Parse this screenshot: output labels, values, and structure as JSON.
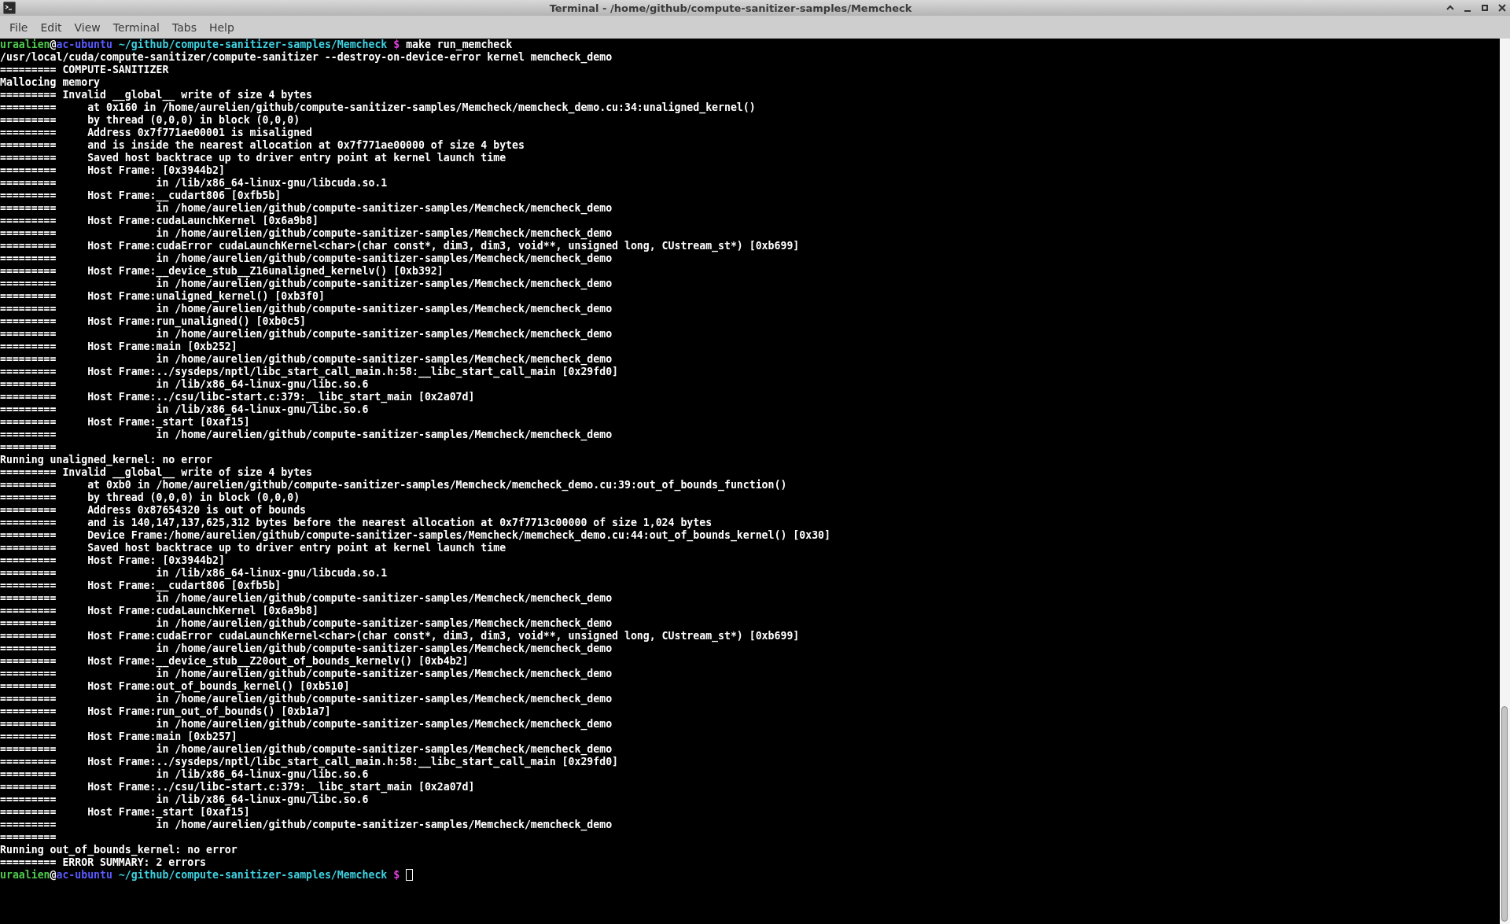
{
  "window": {
    "title": "Terminal - /home/github/compute-sanitizer-samples/Memcheck"
  },
  "menu": [
    "File",
    "Edit",
    "View",
    "Terminal",
    "Tabs",
    "Help"
  ],
  "lines": [
    {
      "kind": "prompt",
      "user": "uraalien",
      "at": "@",
      "host": "ac-ubuntu",
      "path": "~/github/compute-sanitizer-samples/Memcheck",
      "symbol": "$",
      "command": "make run_memcheck"
    },
    {
      "kind": "output",
      "text": "/usr/local/cuda/compute-sanitizer/compute-sanitizer --destroy-on-device-error kernel memcheck_demo"
    },
    {
      "kind": "output",
      "text": "========= COMPUTE-SANITIZER"
    },
    {
      "kind": "output",
      "text": "Mallocing memory"
    },
    {
      "kind": "output",
      "text": "========= Invalid __global__ write of size 4 bytes"
    },
    {
      "kind": "output",
      "text": "=========     at 0x160 in /home/aurelien/github/compute-sanitizer-samples/Memcheck/memcheck_demo.cu:34:unaligned_kernel()"
    },
    {
      "kind": "output",
      "text": "=========     by thread (0,0,0) in block (0,0,0)"
    },
    {
      "kind": "output",
      "text": "=========     Address 0x7f771ae00001 is misaligned"
    },
    {
      "kind": "output",
      "text": "=========     and is inside the nearest allocation at 0x7f771ae00000 of size 4 bytes"
    },
    {
      "kind": "output",
      "text": "=========     Saved host backtrace up to driver entry point at kernel launch time"
    },
    {
      "kind": "output",
      "text": "=========     Host Frame: [0x3944b2]"
    },
    {
      "kind": "output",
      "text": "=========                in /lib/x86_64-linux-gnu/libcuda.so.1"
    },
    {
      "kind": "output",
      "text": "=========     Host Frame:__cudart806 [0xfb5b]"
    },
    {
      "kind": "output",
      "text": "=========                in /home/aurelien/github/compute-sanitizer-samples/Memcheck/memcheck_demo"
    },
    {
      "kind": "output",
      "text": "=========     Host Frame:cudaLaunchKernel [0x6a9b8]"
    },
    {
      "kind": "output",
      "text": "=========                in /home/aurelien/github/compute-sanitizer-samples/Memcheck/memcheck_demo"
    },
    {
      "kind": "output",
      "text": "=========     Host Frame:cudaError cudaLaunchKernel<char>(char const*, dim3, dim3, void**, unsigned long, CUstream_st*) [0xb699]"
    },
    {
      "kind": "output",
      "text": "=========                in /home/aurelien/github/compute-sanitizer-samples/Memcheck/memcheck_demo"
    },
    {
      "kind": "output",
      "text": "=========     Host Frame:__device_stub__Z16unaligned_kernelv() [0xb392]"
    },
    {
      "kind": "output",
      "text": "=========                in /home/aurelien/github/compute-sanitizer-samples/Memcheck/memcheck_demo"
    },
    {
      "kind": "output",
      "text": "=========     Host Frame:unaligned_kernel() [0xb3f0]"
    },
    {
      "kind": "output",
      "text": "=========                in /home/aurelien/github/compute-sanitizer-samples/Memcheck/memcheck_demo"
    },
    {
      "kind": "output",
      "text": "=========     Host Frame:run_unaligned() [0xb0c5]"
    },
    {
      "kind": "output",
      "text": "=========                in /home/aurelien/github/compute-sanitizer-samples/Memcheck/memcheck_demo"
    },
    {
      "kind": "output",
      "text": "=========     Host Frame:main [0xb252]"
    },
    {
      "kind": "output",
      "text": "=========                in /home/aurelien/github/compute-sanitizer-samples/Memcheck/memcheck_demo"
    },
    {
      "kind": "output",
      "text": "=========     Host Frame:../sysdeps/nptl/libc_start_call_main.h:58:__libc_start_call_main [0x29fd0]"
    },
    {
      "kind": "output",
      "text": "=========                in /lib/x86_64-linux-gnu/libc.so.6"
    },
    {
      "kind": "output",
      "text": "=========     Host Frame:../csu/libc-start.c:379:__libc_start_main [0x2a07d]"
    },
    {
      "kind": "output",
      "text": "=========                in /lib/x86_64-linux-gnu/libc.so.6"
    },
    {
      "kind": "output",
      "text": "=========     Host Frame:_start [0xaf15]"
    },
    {
      "kind": "output",
      "text": "=========                in /home/aurelien/github/compute-sanitizer-samples/Memcheck/memcheck_demo"
    },
    {
      "kind": "output",
      "text": "========="
    },
    {
      "kind": "output",
      "text": "Running unaligned_kernel: no error"
    },
    {
      "kind": "output",
      "text": "========= Invalid __global__ write of size 4 bytes"
    },
    {
      "kind": "output",
      "text": "=========     at 0xb0 in /home/aurelien/github/compute-sanitizer-samples/Memcheck/memcheck_demo.cu:39:out_of_bounds_function()"
    },
    {
      "kind": "output",
      "text": "=========     by thread (0,0,0) in block (0,0,0)"
    },
    {
      "kind": "output",
      "text": "=========     Address 0x87654320 is out of bounds"
    },
    {
      "kind": "output",
      "text": "=========     and is 140,147,137,625,312 bytes before the nearest allocation at 0x7f7713c00000 of size 1,024 bytes"
    },
    {
      "kind": "output",
      "text": "=========     Device Frame:/home/aurelien/github/compute-sanitizer-samples/Memcheck/memcheck_demo.cu:44:out_of_bounds_kernel() [0x30]"
    },
    {
      "kind": "output",
      "text": "=========     Saved host backtrace up to driver entry point at kernel launch time"
    },
    {
      "kind": "output",
      "text": "=========     Host Frame: [0x3944b2]"
    },
    {
      "kind": "output",
      "text": "=========                in /lib/x86_64-linux-gnu/libcuda.so.1"
    },
    {
      "kind": "output",
      "text": "=========     Host Frame:__cudart806 [0xfb5b]"
    },
    {
      "kind": "output",
      "text": "=========                in /home/aurelien/github/compute-sanitizer-samples/Memcheck/memcheck_demo"
    },
    {
      "kind": "output",
      "text": "=========     Host Frame:cudaLaunchKernel [0x6a9b8]"
    },
    {
      "kind": "output",
      "text": "=========                in /home/aurelien/github/compute-sanitizer-samples/Memcheck/memcheck_demo"
    },
    {
      "kind": "output",
      "text": "=========     Host Frame:cudaError cudaLaunchKernel<char>(char const*, dim3, dim3, void**, unsigned long, CUstream_st*) [0xb699]"
    },
    {
      "kind": "output",
      "text": "=========                in /home/aurelien/github/compute-sanitizer-samples/Memcheck/memcheck_demo"
    },
    {
      "kind": "output",
      "text": "=========     Host Frame:__device_stub__Z20out_of_bounds_kernelv() [0xb4b2]"
    },
    {
      "kind": "output",
      "text": "=========                in /home/aurelien/github/compute-sanitizer-samples/Memcheck/memcheck_demo"
    },
    {
      "kind": "output",
      "text": "=========     Host Frame:out_of_bounds_kernel() [0xb510]"
    },
    {
      "kind": "output",
      "text": "=========                in /home/aurelien/github/compute-sanitizer-samples/Memcheck/memcheck_demo"
    },
    {
      "kind": "output",
      "text": "=========     Host Frame:run_out_of_bounds() [0xb1a7]"
    },
    {
      "kind": "output",
      "text": "=========                in /home/aurelien/github/compute-sanitizer-samples/Memcheck/memcheck_demo"
    },
    {
      "kind": "output",
      "text": "=========     Host Frame:main [0xb257]"
    },
    {
      "kind": "output",
      "text": "=========                in /home/aurelien/github/compute-sanitizer-samples/Memcheck/memcheck_demo"
    },
    {
      "kind": "output",
      "text": "=========     Host Frame:../sysdeps/nptl/libc_start_call_main.h:58:__libc_start_call_main [0x29fd0]"
    },
    {
      "kind": "output",
      "text": "=========                in /lib/x86_64-linux-gnu/libc.so.6"
    },
    {
      "kind": "output",
      "text": "=========     Host Frame:../csu/libc-start.c:379:__libc_start_main [0x2a07d]"
    },
    {
      "kind": "output",
      "text": "=========                in /lib/x86_64-linux-gnu/libc.so.6"
    },
    {
      "kind": "output",
      "text": "=========     Host Frame:_start [0xaf15]"
    },
    {
      "kind": "output",
      "text": "=========                in /home/aurelien/github/compute-sanitizer-samples/Memcheck/memcheck_demo"
    },
    {
      "kind": "output",
      "text": "========="
    },
    {
      "kind": "output",
      "text": "Running out_of_bounds_kernel: no error"
    },
    {
      "kind": "output",
      "text": "========= ERROR SUMMARY: 2 errors"
    },
    {
      "kind": "prompt",
      "user": "uraalien",
      "at": "@",
      "host": "ac-ubuntu",
      "path": "~/github/compute-sanitizer-samples/Memcheck",
      "symbol": "$",
      "cursor": true
    }
  ]
}
